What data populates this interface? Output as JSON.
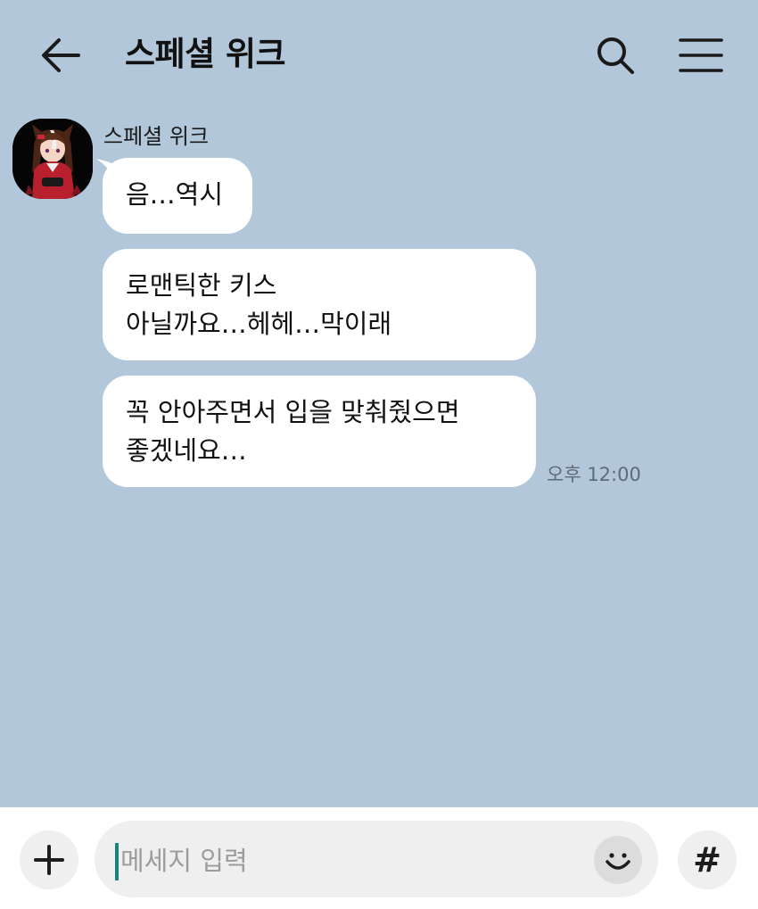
{
  "header": {
    "title": "스페셜 위크",
    "back_icon": "arrow-left-icon",
    "search_icon": "search-icon",
    "menu_icon": "hamburger-menu-icon"
  },
  "chat": {
    "background_color": "#b2c7da",
    "sender": {
      "name": "스페셜 위크",
      "avatar_icon": "profile-avatar"
    },
    "messages": [
      {
        "lines": [
          "음…역시"
        ]
      },
      {
        "lines": [
          "로맨틱한 키스",
          "아닐까요…헤헤…막이래"
        ]
      },
      {
        "lines": [
          "꼭 안아주면서 입을 맞춰줬으면",
          "좋겠네요…"
        ]
      }
    ],
    "timestamp": "오후 12:00"
  },
  "input_bar": {
    "placeholder": "메세지 입력",
    "plus_icon": "plus-icon",
    "emoji_icon": "smiley-emoji-icon",
    "hashtag_label": "#",
    "caret_color": "#14857f"
  }
}
